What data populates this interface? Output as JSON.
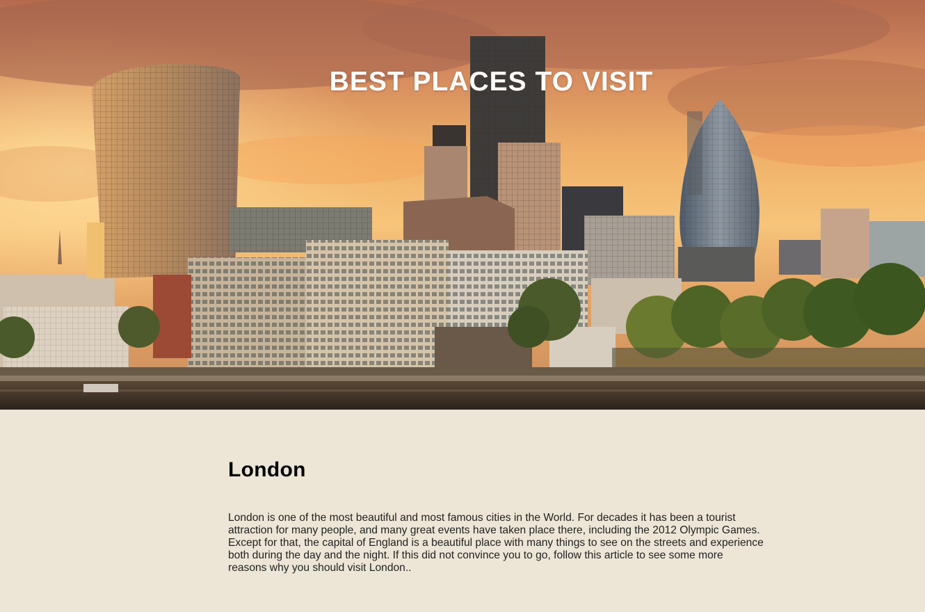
{
  "hero": {
    "title": "BEST PLACES TO VISIT",
    "image": "london-city-skyline-at-sunset"
  },
  "article": {
    "title": "London",
    "body": "London is one of the most beautiful and most famous cities in the World. For decades it has been a tourist attraction for many people, and many great events have taken place there, including the 2012 Olympic Games. Except for that, the capital of England is a beautiful place with many things to see on the streets and experience both during the day and the night. If this did not convince you to go, follow this article to see some more reasons why you should visit London.."
  },
  "colors": {
    "page_background": "#ede6d6",
    "title_text": "#ffffff",
    "heading_text": "#000000",
    "body_text": "#222222"
  }
}
